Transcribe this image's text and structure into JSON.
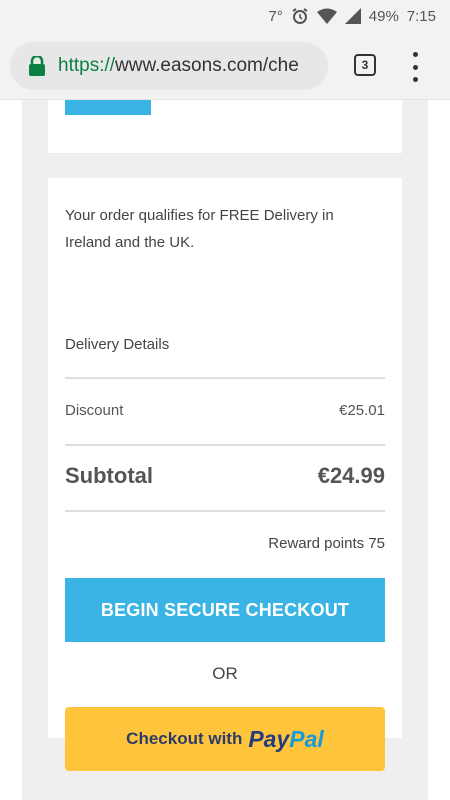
{
  "status_bar": {
    "temperature": "7°",
    "battery": "49%",
    "time": "7:15"
  },
  "browser": {
    "url_scheme": "https://",
    "url_rest": "www.easons.com/che",
    "tab_count": "3"
  },
  "order": {
    "delivery_message": "Your order qualifies for FREE Delivery in Ireland and the UK.",
    "delivery_details_label": "Delivery Details",
    "discount_label": "Discount",
    "discount_value": "€25.01",
    "subtotal_label": "Subtotal",
    "subtotal_value": "€24.99",
    "reward_points_label": "Reward points 75"
  },
  "actions": {
    "checkout_label": "BEGIN SECURE CHECKOUT",
    "or_label": "OR",
    "paypal_prefix": "Checkout with",
    "paypal_logo_pay": "Pay",
    "paypal_logo_pal": "Pal"
  },
  "colors": {
    "accent_blue": "#3ab4e4",
    "paypal_yellow": "#fec43c",
    "url_green": "#0b8043"
  }
}
